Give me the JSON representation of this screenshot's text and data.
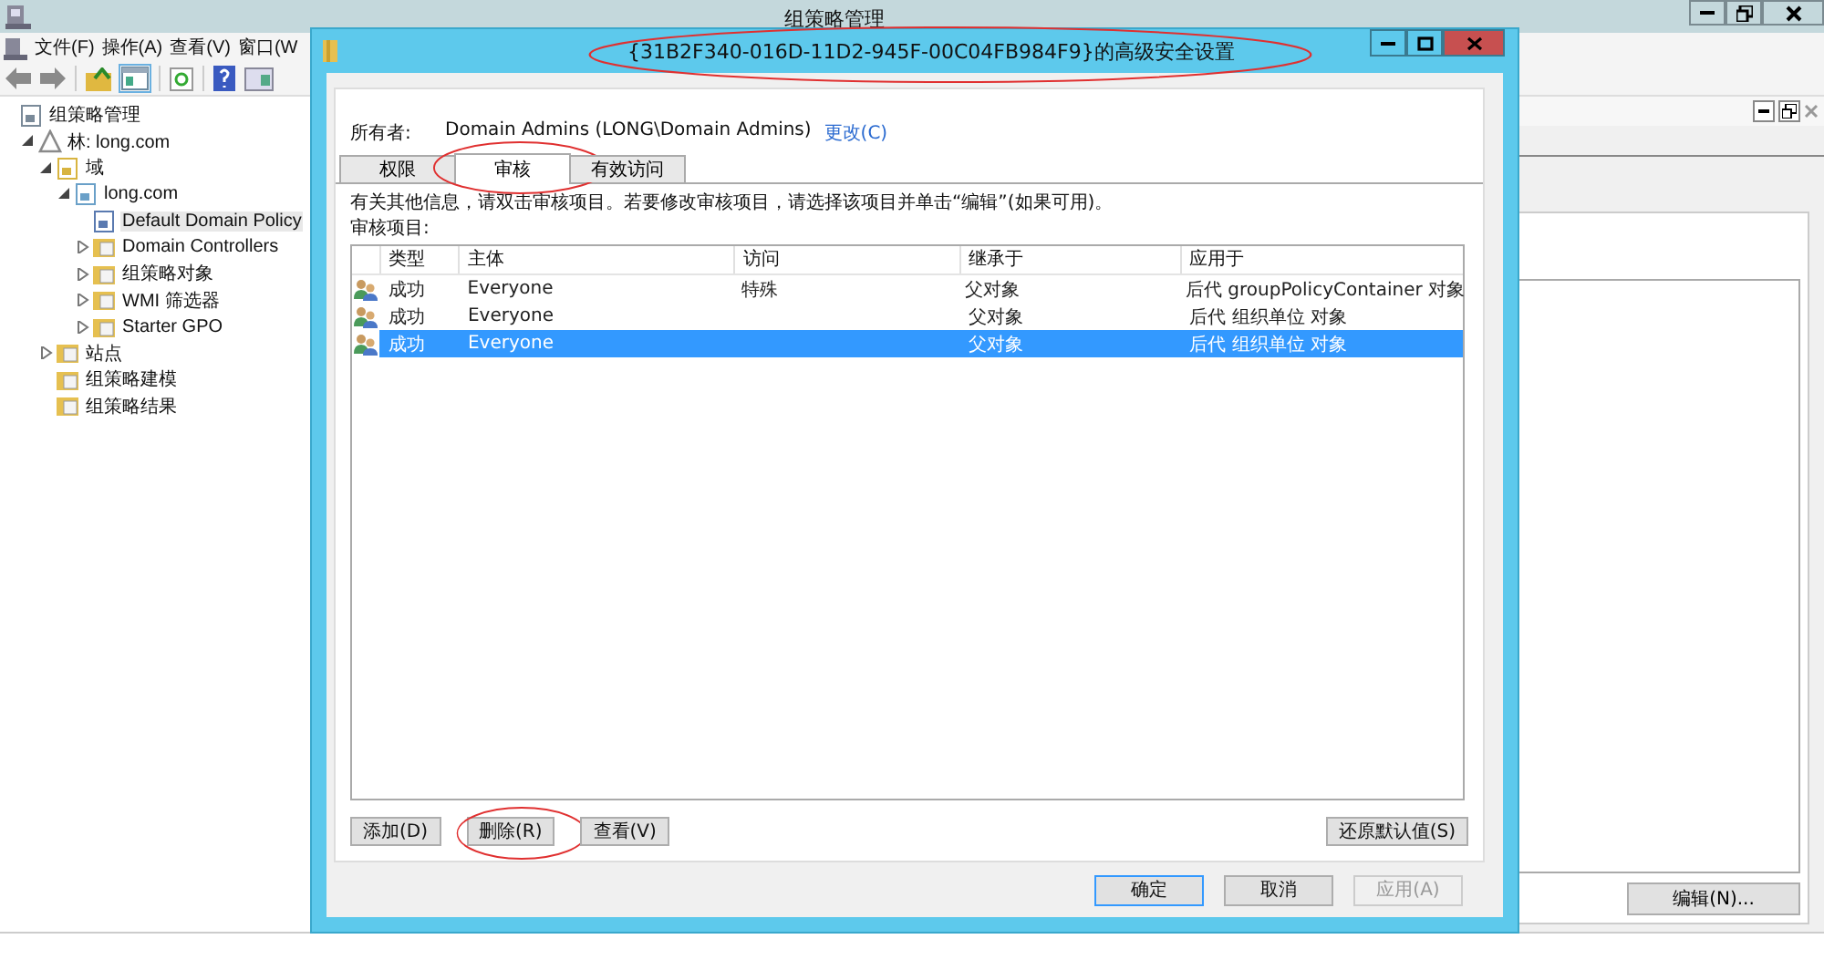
{
  "window": {
    "title": "组策略管理"
  },
  "menu": [
    "文件(F)",
    "操作(A)",
    "查看(V)",
    "窗口(W"
  ],
  "tree": [
    {
      "label": "组策略管理",
      "kind": "console",
      "selected": false,
      "children": [
        {
          "label": "林: long.com",
          "kind": "forest",
          "expanded": true,
          "selected": false,
          "children": [
            {
              "label": "域",
              "kind": "domains",
              "expanded": true,
              "selected": false,
              "children": [
                {
                  "label": "long.com",
                  "kind": "domain",
                  "expanded": true,
                  "selected": false,
                  "children": [
                    {
                      "label": "Default Domain Policy",
                      "kind": "gpo",
                      "selected": true
                    },
                    {
                      "label": "Domain Controllers",
                      "kind": "folder",
                      "expanded": false,
                      "selected": false
                    },
                    {
                      "label": "组策略对象",
                      "kind": "folder",
                      "expanded": false,
                      "selected": false
                    },
                    {
                      "label": "WMI 筛选器",
                      "kind": "folder",
                      "expanded": false,
                      "selected": false
                    },
                    {
                      "label": "Starter GPO",
                      "kind": "folder",
                      "expanded": false,
                      "selected": false
                    }
                  ]
                }
              ]
            },
            {
              "label": "站点",
              "kind": "folder",
              "expanded": false,
              "selected": false
            },
            {
              "label": "组策略建模",
              "kind": "folder",
              "selected": false
            },
            {
              "label": "组策略结果",
              "kind": "folder",
              "selected": false
            }
          ]
        }
      ]
    }
  ],
  "background_button": "编辑(N)...",
  "dialog": {
    "title": "{31B2F340-016D-11D2-945F-00C04FB984F9}的高级安全设置",
    "title_circled": true,
    "owner_label": "所有者:",
    "owner": "Domain Admins (LONG\\Domain Admins)",
    "owner_link": "更改(C)",
    "tabs": [
      {
        "label": "权限",
        "selected": false,
        "circled": false
      },
      {
        "label": "审核",
        "selected": true,
        "circled": true
      },
      {
        "label": "有效访问",
        "selected": false,
        "circled": false
      }
    ],
    "info": "有关其他信息，请双击审核项目。若要修改审核项目，请选择该项目并单击“编辑”(如果可用)。",
    "list_label": "审核项目:",
    "table": {
      "columns": [
        "类型",
        "主体",
        "访问",
        "继承于",
        "应用于"
      ],
      "rows": [
        {
          "cells": [
            "成功",
            "Everyone",
            "特殊",
            "父对象",
            "后代 groupPolicyContainer 对象"
          ],
          "selected": false
        },
        {
          "cells": [
            "成功",
            "Everyone",
            "",
            "父对象",
            "后代 组织单位 对象"
          ],
          "selected": false
        },
        {
          "cells": [
            "成功",
            "Everyone",
            "",
            "父对象",
            "后代 组织单位 对象"
          ],
          "selected": true
        }
      ]
    },
    "actions": [
      {
        "label": "添加(D)",
        "circled": false
      },
      {
        "label": "删除(R)",
        "circled": true
      },
      {
        "label": "查看(V)",
        "circled": false
      }
    ],
    "restore_button": "还原默认值(S)",
    "buttons": [
      {
        "label": "确定",
        "disabled": false
      },
      {
        "label": "取消",
        "disabled": false
      },
      {
        "label": "应用(A)",
        "disabled": true
      }
    ]
  }
}
